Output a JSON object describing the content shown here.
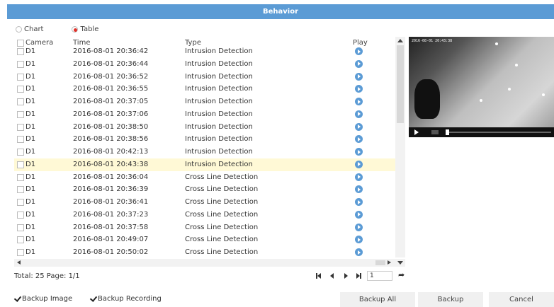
{
  "title": "Behavior",
  "view_toggle": {
    "chart_label": "Chart",
    "table_label": "Table",
    "selected": "Table"
  },
  "table": {
    "headers": {
      "camera": "Camera",
      "time": "Time",
      "type": "Type",
      "play": "Play"
    },
    "rows": [
      {
        "camera": "D1",
        "time": "2016-08-01 20:36:42",
        "type": "Intrusion Detection"
      },
      {
        "camera": "D1",
        "time": "2016-08-01 20:36:44",
        "type": "Intrusion Detection"
      },
      {
        "camera": "D1",
        "time": "2016-08-01 20:36:52",
        "type": "Intrusion Detection"
      },
      {
        "camera": "D1",
        "time": "2016-08-01 20:36:55",
        "type": "Intrusion Detection"
      },
      {
        "camera": "D1",
        "time": "2016-08-01 20:37:05",
        "type": "Intrusion Detection"
      },
      {
        "camera": "D1",
        "time": "2016-08-01 20:37:06",
        "type": "Intrusion Detection"
      },
      {
        "camera": "D1",
        "time": "2016-08-01 20:38:50",
        "type": "Intrusion Detection"
      },
      {
        "camera": "D1",
        "time": "2016-08-01 20:38:56",
        "type": "Intrusion Detection"
      },
      {
        "camera": "D1",
        "time": "2016-08-01 20:42:13",
        "type": "Intrusion Detection"
      },
      {
        "camera": "D1",
        "time": "2016-08-01 20:43:38",
        "type": "Intrusion Detection",
        "selected": true
      },
      {
        "camera": "D1",
        "time": "2016-08-01 20:36:04",
        "type": "Cross Line Detection"
      },
      {
        "camera": "D1",
        "time": "2016-08-01 20:36:39",
        "type": "Cross Line Detection"
      },
      {
        "camera": "D1",
        "time": "2016-08-01 20:36:41",
        "type": "Cross Line Detection"
      },
      {
        "camera": "D1",
        "time": "2016-08-01 20:37:23",
        "type": "Cross Line Detection"
      },
      {
        "camera": "D1",
        "time": "2016-08-01 20:37:58",
        "type": "Cross Line Detection"
      },
      {
        "camera": "D1",
        "time": "2016-08-01 20:49:07",
        "type": "Cross Line Detection"
      },
      {
        "camera": "D1",
        "time": "2016-08-01 20:50:02",
        "type": "Cross Line Detection"
      }
    ]
  },
  "video": {
    "osd_text": "2016-08-01 20:43:38"
  },
  "footer": {
    "total_text": "Total: 25  Page: 1/1",
    "page_value": "1"
  },
  "options": {
    "backup_image_label": "Backup Image",
    "backup_recording_label": "Backup Recording"
  },
  "buttons": {
    "backup_all": "Backup All",
    "backup": "Backup",
    "cancel": "Cancel"
  },
  "colors": {
    "title_bar": "#5b9bd5",
    "play_icon": "#5b9bd5",
    "selected_row": "#fff9d6",
    "radio_selected": "#e0312a"
  }
}
